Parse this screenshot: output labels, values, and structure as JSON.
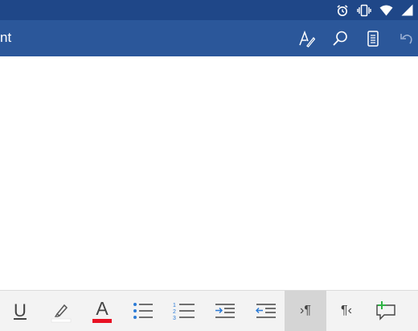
{
  "status_bar": {
    "icons": [
      "alarm-icon",
      "vibrate-icon",
      "wifi-icon",
      "signal-icon"
    ]
  },
  "app_bar": {
    "title": "nt",
    "actions": [
      "text-style-icon",
      "search-icon",
      "reading-view-icon",
      "undo-icon"
    ]
  },
  "colors": {
    "app_bar": "#2b579a",
    "status_bar": "#1f4788",
    "font_color_swatch": "#e81123",
    "highlight_swatch": "#ffffff",
    "accent_blue": "#2b7bd6",
    "comment_plus": "#2fb344"
  },
  "ribbon": {
    "tools": [
      {
        "name": "underline-button",
        "glyph": "U"
      },
      {
        "name": "highlight-button",
        "glyph": ""
      },
      {
        "name": "font-color-button",
        "glyph": "A"
      },
      {
        "name": "bullets-button",
        "glyph": ""
      },
      {
        "name": "numbering-button",
        "glyph": ""
      },
      {
        "name": "increase-indent-button",
        "glyph": ""
      },
      {
        "name": "decrease-indent-button",
        "glyph": ""
      },
      {
        "name": "ltr-paragraph-button",
        "glyph": "›¶",
        "active": true
      },
      {
        "name": "rtl-paragraph-button",
        "glyph": "¶‹"
      },
      {
        "name": "new-comment-button",
        "glyph": ""
      }
    ]
  }
}
